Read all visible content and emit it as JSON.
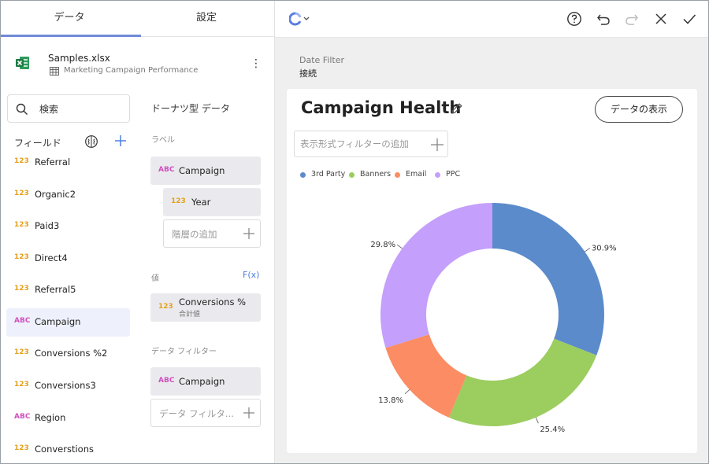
{
  "tabs": {
    "data": "データ",
    "settings": "設定"
  },
  "file": {
    "name": "Samples.xlsx",
    "sheet": "Marketing Campaign Performance",
    "menu": "⋮"
  },
  "search": {
    "label": "検索"
  },
  "fields": {
    "heading": "フィールド",
    "items": [
      {
        "type": "123",
        "name": "Referral"
      },
      {
        "type": "123",
        "name": "Organic2"
      },
      {
        "type": "123",
        "name": "Paid3"
      },
      {
        "type": "123",
        "name": "Direct4"
      },
      {
        "type": "123",
        "name": "Referral5"
      },
      {
        "type": "ABC",
        "name": "Campaign"
      },
      {
        "type": "123",
        "name": "Conversions %2"
      },
      {
        "type": "123",
        "name": "Conversions3"
      },
      {
        "type": "ABC",
        "name": "Region"
      },
      {
        "type": "123",
        "name": "Converstions"
      }
    ]
  },
  "config": {
    "title": "ドーナツ型 データ",
    "label_section": "ラベル",
    "label_chips": [
      {
        "type": "ABC",
        "name": "Campaign"
      },
      {
        "type": "123",
        "name": "Year"
      }
    ],
    "add_hierarchy": "階層の追加",
    "value_section": "値",
    "fx": "F(x)",
    "value_chip": {
      "type": "123",
      "name": "Conversions %",
      "sub": "合計値"
    },
    "filter_section": "データ フィルター",
    "filter_chip": {
      "type": "ABC",
      "name": "Campaign"
    },
    "add_filter": "データ フィルタ..."
  },
  "date_filter": {
    "label": "Date Filter",
    "value": "接続"
  },
  "card": {
    "title": "Campaign Health",
    "show_data": "データの表示",
    "add_visual_filter": "表示形式フィルターの追加"
  },
  "chart_data": {
    "type": "pie",
    "title": "Campaign Health",
    "categories": [
      "3rd Party",
      "Banners",
      "Email",
      "PPC"
    ],
    "values": [
      30.9,
      25.4,
      13.8,
      29.8
    ],
    "labels": [
      "30.9%",
      "25.4%",
      "13.8%",
      "29.8%"
    ],
    "colors": [
      "#5b8bca",
      "#9ccd5f",
      "#fb8c63",
      "#c49ffb"
    ],
    "legend": "top-left",
    "donut": true
  }
}
